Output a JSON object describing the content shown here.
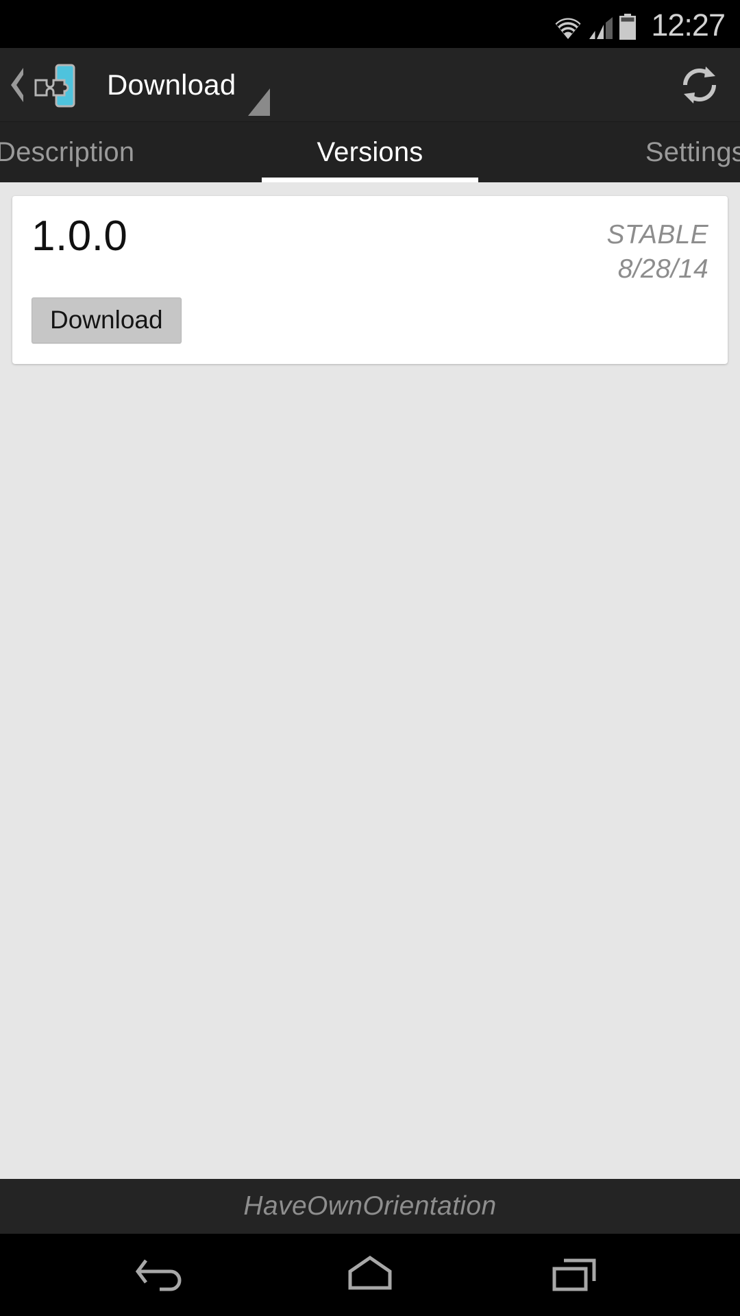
{
  "statusbar": {
    "time": "12:27",
    "icons": {
      "wifi": "wifi-icon",
      "signal": "cellular-signal-icon",
      "battery": "battery-icon"
    },
    "signal_bars_filled": 2,
    "signal_bars_total": 4
  },
  "actionbar": {
    "title": "Download",
    "up_icon": "back-chevron-icon",
    "app_icon": "puzzle-phone-app-icon",
    "refresh_icon": "refresh-icon",
    "marker_icon": "dropdown-triangle-icon",
    "accent_color": "#4ec3dd",
    "background_color": "#242424"
  },
  "tabs": [
    {
      "label": "Description",
      "active": false
    },
    {
      "label": "Versions",
      "active": true
    },
    {
      "label": "Settings",
      "active": false
    }
  ],
  "content": {
    "background_color": "#e6e6e6",
    "versions": [
      {
        "version": "1.0.0",
        "channel": "STABLE",
        "date": "8/28/14",
        "action_label": "Download"
      }
    ]
  },
  "footer": {
    "text": "HaveOwnOrientation"
  },
  "navbar": {
    "back_icon": "nav-back-icon",
    "home_icon": "nav-home-icon",
    "recents_icon": "nav-recents-icon"
  }
}
